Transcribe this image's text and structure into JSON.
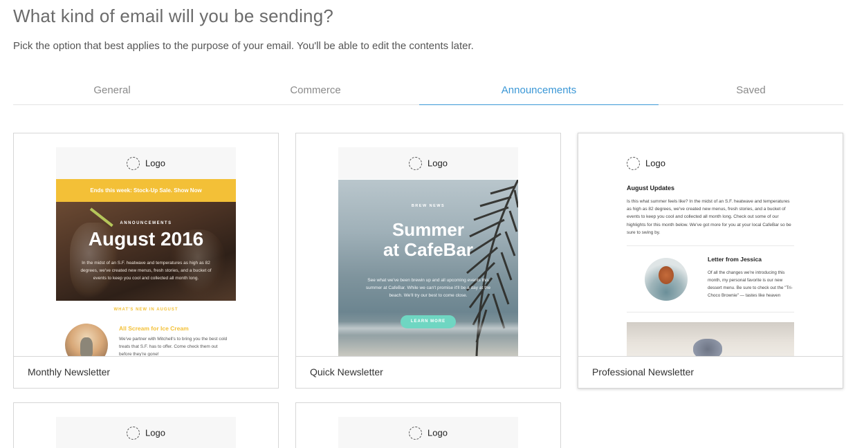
{
  "header": {
    "title": "What kind of email will you be sending?",
    "subtitle": "Pick the option that best applies to the purpose of your email. You'll be able to edit the contents later."
  },
  "tabs": [
    {
      "label": "General",
      "active": false
    },
    {
      "label": "Commerce",
      "active": false
    },
    {
      "label": "Announcements",
      "active": true
    },
    {
      "label": "Saved",
      "active": false
    }
  ],
  "colors": {
    "accent": "#3a97d6",
    "banner": "#f3c037",
    "button_teal": "#6fd6c2"
  },
  "templates": [
    {
      "name": "Monthly Newsletter",
      "preview": {
        "logo": "Logo",
        "banner": "Ends this week: Stock-Up Sale. Show Now",
        "kicker": "ANNOUNCEMENTS",
        "heading": "August 2016",
        "body": "In the midst of an S.F. heatwave and temperatures as high as 82 degrees, we've created new menus, fresh stories, and a bucket of events to keep you cool and collected all month long.",
        "section": "WHAT'S NEW IN AUGUST",
        "item_title": "All Scream for Ice Cream",
        "item_body": "We've partner with Mitchell's to bring you the best cold treats that S.F. has to offer. Come check them out before they're gone!"
      }
    },
    {
      "name": "Quick Newsletter",
      "preview": {
        "logo": "Logo",
        "kicker": "BREW NEWS",
        "heading_line1": "Summer",
        "heading_line2": "at CafeBar",
        "body": "See what we've been brewin up and all upcoming events this summer at CafeBar. While we can't promise it'll be a day at the beach. We'll try our best to come close.",
        "button": "LEARN MORE"
      }
    },
    {
      "name": "Professional Newsletter",
      "preview": {
        "logo": "Logo",
        "heading": "August Updates",
        "body": "Is this what summer feels like? In the midst of an S.F. heatwave and temperatures as high as 82 degrees, we've created new menus, fresh stories, and a bucket of events to keep you cool and collected all month long. Check out some of our highlights for this month below. We've got more for you at your local CafeBar so be sure to swing by.",
        "letter_title": "Letter from Jessica",
        "letter_body": "Of all the changes we're introducing this month, my personal favorite is our new dessert menu. Be sure to check out the \"Tri-Choco Brownie\" — tastes like heaven"
      }
    },
    {
      "name": "",
      "preview": {
        "logo": "Logo"
      }
    },
    {
      "name": "",
      "preview": {
        "logo": "Logo"
      }
    }
  ]
}
